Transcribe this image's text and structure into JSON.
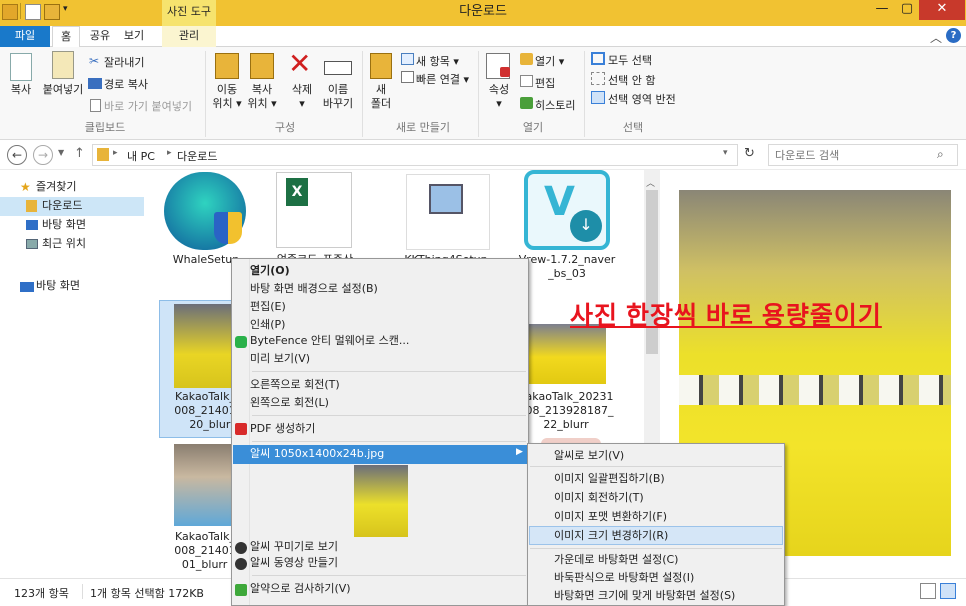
{
  "window": {
    "title": "다운로드",
    "context_tab": "사진 도구"
  },
  "tabs": [
    "파일",
    "홈",
    "공유",
    "보기",
    "관리"
  ],
  "ribbon": {
    "clipboard": {
      "copy": "복사",
      "paste": "붙여넣기",
      "cut": "잘라내기",
      "copy_path": "경로 복사",
      "paste_shortcut": "바로 가기 붙여넣기",
      "group": "클립보드"
    },
    "organize": {
      "move": "이동\n위치 ▾",
      "copy": "복사\n위치 ▾",
      "delete": "삭제\n▾",
      "rename": "이름\n바꾸기",
      "group": "구성"
    },
    "new": {
      "folder": "새\n폴더",
      "new_item": "새 항목 ▾",
      "easy_access": "빠른 연결 ▾",
      "group": "새로 만들기"
    },
    "open": {
      "properties": "속성\n▾",
      "open": "열기 ▾",
      "edit": "편집",
      "history": "히스토리",
      "group": "열기"
    },
    "select": {
      "all": "모두 선택",
      "none": "선택 안 함",
      "invert": "선택 영역 반전",
      "group": "선택"
    }
  },
  "address": {
    "path": [
      "내 PC",
      "다운로드"
    ],
    "search_placeholder": "다운로드 검색"
  },
  "nav": {
    "favorites": "즐겨찾기",
    "downloads": "다운로드",
    "desktop": "바탕 화면",
    "recent": "최근 위치",
    "desktop2": "바탕 화면"
  },
  "files": [
    {
      "name": "WhaleSetup"
    },
    {
      "name": "업종코드_표준산"
    },
    {
      "name": "KKThing4Setup"
    },
    {
      "name": "Vrew-1.7.2_naver\n_bs_03"
    },
    {
      "name": "KakaoTalk_20\n008_2140111\n20_blurr"
    },
    {
      "name": "KakaoTalk_20231\n008_213928187_\n22_blurr"
    },
    {
      "name": "KakaoTalk_20\n008_2140111\n01_blurr (1"
    }
  ],
  "overlay_caption": "사진 한장씩 바로 용량줄이기",
  "status": {
    "count": "123개 항목",
    "selected": "1개 항목 선택함 172KB"
  },
  "context_menu": {
    "items": [
      "열기(O)",
      "바탕 화면 배경으로 설정(B)",
      "편집(E)",
      "인쇄(P)",
      "ByteFence 안티 멀웨어로 스캔...",
      "미리 보기(V)",
      "오른쪽으로 회전(T)",
      "왼쪽으로 회전(L)",
      "PDF 생성하기",
      "알씨 1050x1400x24b.jpg",
      "알씨 꾸미기로 보기",
      "알씨 동영상 만들기",
      "알약으로 검사하기(V)"
    ]
  },
  "submenu": {
    "items": [
      "알씨로 보기(V)",
      "이미지 일괄편집하기(B)",
      "이미지 회전하기(T)",
      "이미지 포맷 변환하기(F)",
      "이미지 크기 변경하기(R)",
      "가운데로 바탕화면 설정(C)",
      "바둑판식으로 바탕화면 설정(I)",
      "바탕화면 크기에 맞게 바탕화면 설정(S)"
    ]
  },
  "colors": {
    "title_bg": "#f1c232",
    "file_tab": "#1979ca",
    "highlight": "#3a8ed8",
    "caption": "#e8141e"
  }
}
